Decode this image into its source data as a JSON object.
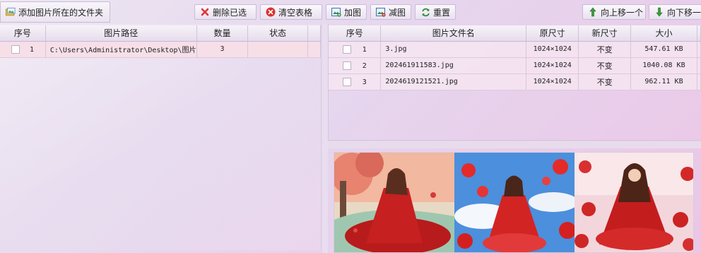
{
  "toolbar": {
    "add_folder": "添加图片所在的文件夹",
    "delete_selected": "删除已选",
    "clear_table": "清空表格",
    "add_image": "加图",
    "remove_image": "减图",
    "reset": "重置",
    "move_up": "向上移一个",
    "move_down": "向下移一个"
  },
  "left_table": {
    "headers": [
      "序号",
      "图片路径",
      "数量",
      "状态"
    ],
    "rows": [
      {
        "index": "1",
        "path": "C:\\Users\\Administrator\\Desktop\\图片",
        "count": "3",
        "status": ""
      }
    ]
  },
  "right_table": {
    "headers": [
      "序号",
      "图片文件名",
      "原尺寸",
      "新尺寸",
      "大小"
    ],
    "rows": [
      {
        "index": "1",
        "name": "3.jpg",
        "orig": "1024×1024",
        "new": "不变",
        "size": "547.61 KB"
      },
      {
        "index": "2",
        "name": "202461911583.jpg",
        "orig": "1024×1024",
        "new": "不变",
        "size": "1040.08 KB"
      },
      {
        "index": "3",
        "name": "2024619121521.jpg",
        "orig": "1024×1024",
        "new": "不变",
        "size": "962.11 KB"
      }
    ]
  },
  "icons": {
    "add_folder": "folder-image-icon",
    "delete": "red-x-icon",
    "clear": "red-circle-x-icon",
    "add_image": "add-image-icon",
    "remove_image": "remove-image-icon",
    "reset": "refresh-icon",
    "up": "green-up-arrow-icon",
    "down": "green-down-arrow-icon"
  }
}
